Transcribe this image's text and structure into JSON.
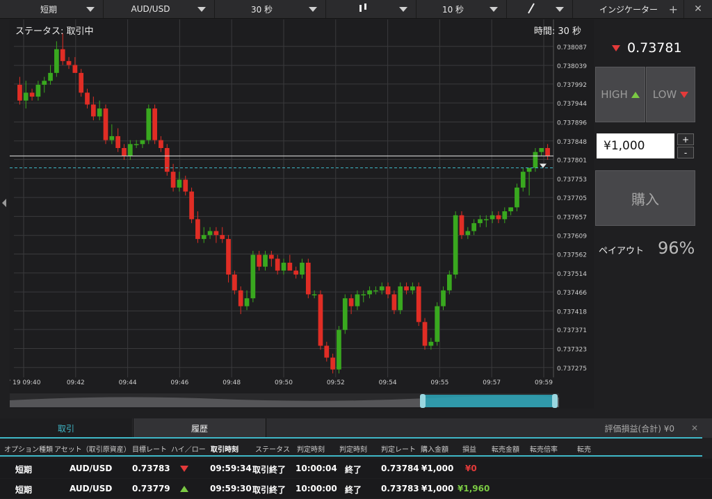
{
  "toolbar": {
    "option_type": "短期",
    "asset": "AUD/USD",
    "expiry": "30 秒",
    "candle_interval": "10 秒",
    "indicator_label": "インジケーター",
    "plus": "+",
    "close": "✕"
  },
  "chart": {
    "status": "ステータス: 取引中",
    "timeframe": "時間: 30 秒"
  },
  "chart_data": {
    "type": "candlestick",
    "yticks": [
      "0.738087",
      "0.738039",
      "0.737992",
      "0.737944",
      "0.737896",
      "0.737848",
      "0.737801",
      "0.737753",
      "0.737705",
      "0.737657",
      "0.737609",
      "0.737562",
      "0.737514",
      "0.737466",
      "0.737418",
      "0.737371",
      "0.737323",
      "0.737275"
    ],
    "ylim": [
      0.73725,
      0.73812
    ],
    "xticks": [
      "7 19 09:40",
      "09:42",
      "09:44",
      "09:46",
      "09:48",
      "09:50",
      "09:52",
      "09:54",
      "09:55",
      "09:57",
      "09:59"
    ],
    "current_rate_line": 0.73781,
    "target_rate_line": 0.73778,
    "candles": [
      [
        0.73799,
        0.73801,
        0.73794,
        0.73795
      ],
      [
        0.73795,
        0.738,
        0.73793,
        0.73797
      ],
      [
        0.73797,
        0.73798,
        0.73795,
        0.73796
      ],
      [
        0.73796,
        0.738,
        0.73795,
        0.73799
      ],
      [
        0.73799,
        0.73801,
        0.73797,
        0.738
      ],
      [
        0.738,
        0.73804,
        0.73799,
        0.73802
      ],
      [
        0.73802,
        0.7381,
        0.73801,
        0.73808
      ],
      [
        0.73808,
        0.73812,
        0.73804,
        0.73805
      ],
      [
        0.73805,
        0.73806,
        0.73803,
        0.73804
      ],
      [
        0.73804,
        0.73806,
        0.73803,
        0.73802
      ],
      [
        0.73802,
        0.73803,
        0.73796,
        0.73797
      ],
      [
        0.73797,
        0.73798,
        0.73793,
        0.73794
      ],
      [
        0.73794,
        0.73796,
        0.7379,
        0.73791
      ],
      [
        0.73791,
        0.73795,
        0.7379,
        0.73793
      ],
      [
        0.73793,
        0.73794,
        0.73784,
        0.73785
      ],
      [
        0.73785,
        0.73789,
        0.73784,
        0.73786
      ],
      [
        0.73786,
        0.73788,
        0.73782,
        0.73783
      ],
      [
        0.73783,
        0.73784,
        0.7378,
        0.73781
      ],
      [
        0.73781,
        0.73785,
        0.7378,
        0.73784
      ],
      [
        0.73784,
        0.73785,
        0.73783,
        0.73784
      ],
      [
        0.73784,
        0.73785,
        0.73783,
        0.73785
      ],
      [
        0.73785,
        0.73794,
        0.73784,
        0.73793
      ],
      [
        0.73793,
        0.73794,
        0.73784,
        0.73785
      ],
      [
        0.73785,
        0.73786,
        0.73782,
        0.73783
      ],
      [
        0.73783,
        0.73784,
        0.73776,
        0.73777
      ],
      [
        0.73777,
        0.73779,
        0.73772,
        0.73773
      ],
      [
        0.73773,
        0.73777,
        0.73772,
        0.73775
      ],
      [
        0.73775,
        0.73776,
        0.73771,
        0.73772
      ],
      [
        0.73772,
        0.73773,
        0.73764,
        0.73765
      ],
      [
        0.73765,
        0.73767,
        0.73759,
        0.7376
      ],
      [
        0.7376,
        0.73763,
        0.73759,
        0.73761
      ],
      [
        0.73761,
        0.73763,
        0.7376,
        0.73762
      ],
      [
        0.73762,
        0.73763,
        0.73759,
        0.73761
      ],
      [
        0.73761,
        0.73763,
        0.73759,
        0.7376
      ],
      [
        0.7376,
        0.73761,
        0.73749,
        0.73751
      ],
      [
        0.73751,
        0.73752,
        0.73746,
        0.73747
      ],
      [
        0.73747,
        0.73748,
        0.73741,
        0.73743
      ],
      [
        0.73743,
        0.73747,
        0.73742,
        0.73745
      ],
      [
        0.73745,
        0.73757,
        0.73744,
        0.73756
      ],
      [
        0.73756,
        0.73757,
        0.73752,
        0.73753
      ],
      [
        0.73753,
        0.73757,
        0.73752,
        0.73756
      ],
      [
        0.73756,
        0.73757,
        0.73753,
        0.73755
      ],
      [
        0.73755,
        0.73756,
        0.73751,
        0.73752
      ],
      [
        0.73752,
        0.73755,
        0.73751,
        0.73754
      ],
      [
        0.73754,
        0.73756,
        0.73753,
        0.73752
      ],
      [
        0.73752,
        0.73753,
        0.7375,
        0.73751
      ],
      [
        0.73751,
        0.73755,
        0.7375,
        0.73754
      ],
      [
        0.73754,
        0.73755,
        0.73745,
        0.73746
      ],
      [
        0.73746,
        0.73747,
        0.73745,
        0.73746
      ],
      [
        0.73746,
        0.73747,
        0.73732,
        0.73733
      ],
      [
        0.73733,
        0.73734,
        0.73729,
        0.7373
      ],
      [
        0.7373,
        0.73731,
        0.73726,
        0.73727
      ],
      [
        0.73727,
        0.73738,
        0.73726,
        0.73737
      ],
      [
        0.73737,
        0.73746,
        0.73736,
        0.73745
      ],
      [
        0.73745,
        0.73746,
        0.73741,
        0.73743
      ],
      [
        0.73743,
        0.73747,
        0.73742,
        0.73746
      ],
      [
        0.73746,
        0.73747,
        0.73744,
        0.73746
      ],
      [
        0.73746,
        0.73748,
        0.73745,
        0.73747
      ],
      [
        0.73747,
        0.73748,
        0.73746,
        0.73747
      ],
      [
        0.73747,
        0.73749,
        0.73746,
        0.73748
      ],
      [
        0.73748,
        0.73749,
        0.73745,
        0.73746
      ],
      [
        0.73746,
        0.73747,
        0.73741,
        0.73742
      ],
      [
        0.73742,
        0.73749,
        0.73741,
        0.73748
      ],
      [
        0.73748,
        0.73749,
        0.73746,
        0.73747
      ],
      [
        0.73747,
        0.73749,
        0.73746,
        0.73748
      ],
      [
        0.73748,
        0.73749,
        0.73738,
        0.73739
      ],
      [
        0.73739,
        0.7374,
        0.73732,
        0.73733
      ],
      [
        0.73733,
        0.73735,
        0.73732,
        0.73734
      ],
      [
        0.73734,
        0.73744,
        0.73733,
        0.73743
      ],
      [
        0.73743,
        0.73748,
        0.73742,
        0.73747
      ],
      [
        0.73747,
        0.73752,
        0.73746,
        0.73751
      ],
      [
        0.73751,
        0.73767,
        0.7375,
        0.73766
      ],
      [
        0.73766,
        0.73767,
        0.7376,
        0.73761
      ],
      [
        0.73761,
        0.73763,
        0.7376,
        0.73762
      ],
      [
        0.73762,
        0.73765,
        0.73761,
        0.73764
      ],
      [
        0.73764,
        0.73766,
        0.73763,
        0.73765
      ],
      [
        0.73765,
        0.73766,
        0.73763,
        0.73765
      ],
      [
        0.73765,
        0.73767,
        0.73764,
        0.73766
      ],
      [
        0.73766,
        0.73767,
        0.73764,
        0.73765
      ],
      [
        0.73765,
        0.73768,
        0.73764,
        0.73767
      ],
      [
        0.73767,
        0.73768,
        0.73766,
        0.73768
      ],
      [
        0.73768,
        0.73774,
        0.73767,
        0.73773
      ],
      [
        0.73773,
        0.73778,
        0.73772,
        0.73777
      ],
      [
        0.73777,
        0.73778,
        0.73771,
        0.73778
      ],
      [
        0.73778,
        0.73783,
        0.73777,
        0.73782
      ],
      [
        0.73782,
        0.73783,
        0.73781,
        0.73783
      ],
      [
        0.73783,
        0.73784,
        0.7378,
        0.73781
      ]
    ]
  },
  "panel": {
    "current_rate": "0.73781",
    "high_label": "HIGH",
    "low_label": "LOW",
    "amount": "¥1,000",
    "plus": "+",
    "minus": "-",
    "buy_label": "購入",
    "payout_label": "ペイアウト",
    "payout_value": "96%"
  },
  "bottom": {
    "tab_trade": "取引",
    "tab_history": "履歴",
    "pnl_label": "評価損益(合計)  ¥0",
    "collapse": "✕",
    "headers": [
      "オプション種類",
      "アセット（取引原資産）",
      "目標レート",
      "ハイ／ロー",
      "取引時刻",
      "ステータス",
      "判定時刻",
      "判定時刻",
      "判定レート",
      "購入金額",
      "損益",
      "転売金額",
      "転売倍率",
      "転売"
    ],
    "rows": [
      {
        "option": "短期",
        "asset": "AUD/USD",
        "target": "0.73783",
        "dir": "low",
        "time": "09:59:34",
        "status": "取引終了",
        "judge_time": "10:00:04",
        "judge_status": "終了",
        "judge_rate": "0.73784",
        "amount": "¥1,000",
        "pnl": "¥0",
        "pnl_color": "#e43a3a"
      },
      {
        "option": "短期",
        "asset": "AUD/USD",
        "target": "0.73779",
        "dir": "high",
        "time": "09:59:30",
        "status": "取引終了",
        "judge_time": "10:00:00",
        "judge_status": "終了",
        "judge_rate": "0.73783",
        "amount": "¥1,000",
        "pnl": "¥1,960",
        "pnl_color": "#7ac943"
      }
    ]
  }
}
